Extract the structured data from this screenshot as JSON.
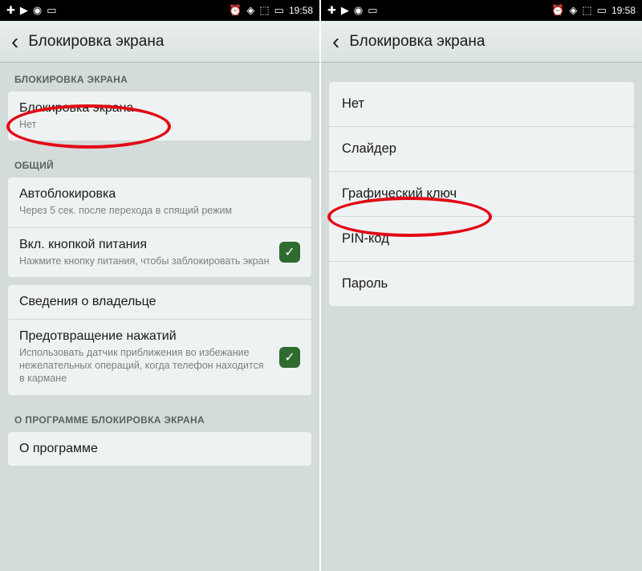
{
  "status": {
    "time": "19:58"
  },
  "left": {
    "headerTitle": "Блокировка экрана",
    "sections": {
      "s1Label": "БЛОКИРОВКА ЭКРАНА",
      "s2Label": "ОБЩИЙ",
      "s3Label": "О ПРОГРАММЕ БЛОКИРОВКА ЭКРАНА"
    },
    "items": {
      "lock": {
        "title": "Блокировка экрана",
        "sub": "Нет"
      },
      "autolock": {
        "title": "Автоблокировка",
        "sub": "Через 5 сек. после перехода в спящий режим"
      },
      "powerBtn": {
        "title": "Вкл. кнопкой питания",
        "sub": "Нажмите кнопку питания, чтобы заблокировать экран"
      },
      "owner": {
        "title": "Сведения о владельце"
      },
      "prevent": {
        "title": "Предотвращение нажатий",
        "sub": "Использовать датчик приближения во избежание нежелательных операций, когда телефон находится в кармане"
      },
      "about": {
        "title": "О программе"
      }
    }
  },
  "right": {
    "headerTitle": "Блокировка экрана",
    "options": {
      "none": "Нет",
      "slider": "Слайдер",
      "pattern": "Графический ключ",
      "pin": "PIN-код",
      "password": "Пароль"
    }
  }
}
